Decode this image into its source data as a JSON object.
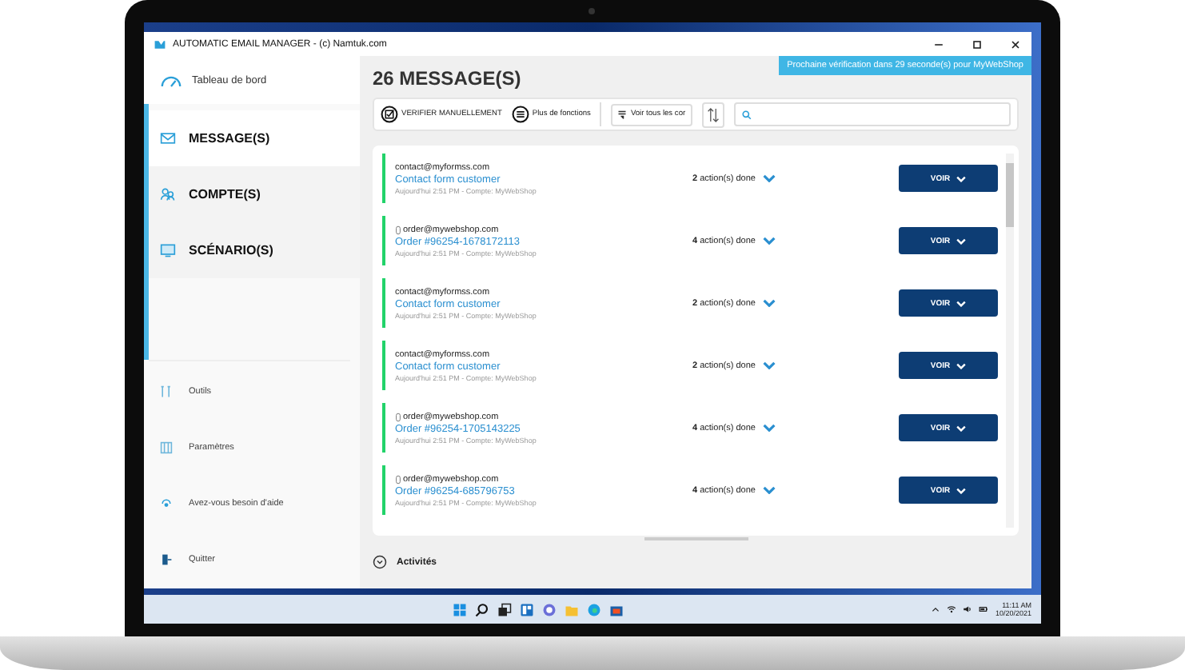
{
  "window": {
    "title": "AUTOMATIC EMAIL MANAGER - (c) Namtuk.com"
  },
  "sidebar": {
    "top_item": {
      "label": "Tableau de bord"
    },
    "items": [
      {
        "label": "MESSAGE(S)",
        "kind": "mail",
        "selected": true
      },
      {
        "label": "COMPTE(S)",
        "kind": "users",
        "selected": false
      },
      {
        "label": "SCÉNARIO(S)",
        "kind": "screen",
        "selected": false
      }
    ],
    "bottom_items": [
      {
        "label": "Outils",
        "kind": "tools"
      },
      {
        "label": "Paramètres",
        "kind": "settings"
      },
      {
        "label": "Avez-vous besoin d'aide",
        "kind": "help"
      },
      {
        "label": "Quitter",
        "kind": "exit"
      }
    ]
  },
  "main": {
    "title": "26 MESSAGE(S)",
    "notice": "Prochaine vérification dans 29 seconde(s) pour MyWebShop",
    "toolbar": {
      "verify": "VERIFIER MANUELLEMENT",
      "more": "Plus de fonctions",
      "filter": "Voir tous les cor"
    }
  },
  "messages": [
    {
      "kind": "contact",
      "from": "contact@myformss.com",
      "subject": "Contact form customer",
      "meta": "Aujourd'hui 2:51 PM - Compte: MyWebShop",
      "actions": "**2** action(s) done",
      "button": "VOIR"
    },
    {
      "kind": "order",
      "from": "order@mywebshop.com",
      "subject": "Order #96254-1678172113",
      "meta": "Aujourd'hui 2:51 PM - Compte: MyWebShop",
      "actions": "**4** action(s) done",
      "button": "VOIR"
    },
    {
      "kind": "contact",
      "from": "contact@myformss.com",
      "subject": "Contact form customer",
      "meta": "Aujourd'hui 2:51 PM - Compte: MyWebShop",
      "actions": "**2** action(s) done",
      "button": "VOIR"
    },
    {
      "kind": "contact",
      "from": "contact@myformss.com",
      "subject": "Contact form customer",
      "meta": "Aujourd'hui 2:51 PM - Compte: MyWebShop",
      "actions": "**2** action(s) done",
      "button": "VOIR"
    },
    {
      "kind": "order",
      "from": "order@mywebshop.com",
      "subject": "Order #96254-1705143225",
      "meta": "Aujourd'hui 2:51 PM - Compte: MyWebShop",
      "actions": "**4** action(s) done",
      "button": "VOIR"
    },
    {
      "kind": "order",
      "from": "order@mywebshop.com",
      "subject": "Order #96254-685796753",
      "meta": "Aujourd'hui 2:51 PM - Compte: MyWebShop",
      "actions": "**4** action(s) done",
      "button": "VOIR"
    }
  ],
  "activities": {
    "label": "Activités"
  },
  "taskbar": {
    "time": "11:11 AM",
    "date": "10/20/2021"
  }
}
